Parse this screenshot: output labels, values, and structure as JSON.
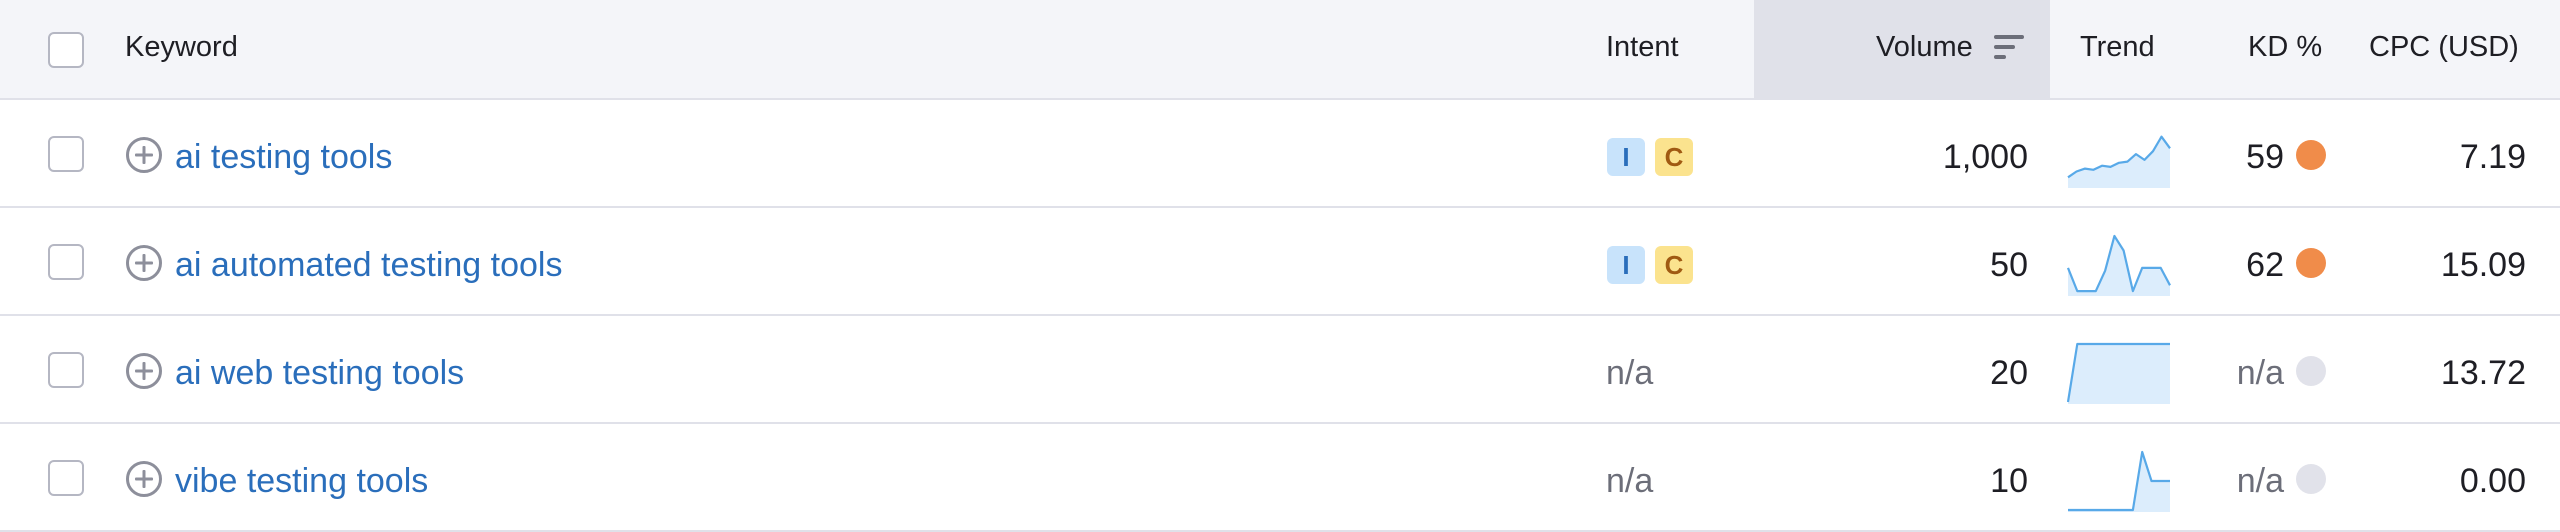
{
  "header": {
    "keyword": "Keyword",
    "intent": "Intent",
    "volume": "Volume",
    "trend": "Trend",
    "kd": "KD %",
    "cpc": "CPC (USD)"
  },
  "colors": {
    "link": "#2a6ebb",
    "kd_high": "#f08c4a",
    "kd_none": "#e1e2ea",
    "spark_line": "#58a9e8",
    "spark_fill": "#dcedfc",
    "intent_i_bg": "#c8e3fb",
    "intent_c_bg": "#fbe38e"
  },
  "rows": [
    {
      "keyword": "ai testing tools",
      "intent": [
        "I",
        "C"
      ],
      "volume": "1,000",
      "trend": [
        0.15,
        0.25,
        0.3,
        0.28,
        0.35,
        0.33,
        0.4,
        0.42,
        0.55,
        0.45,
        0.6,
        0.85,
        0.65
      ],
      "kd": "59",
      "kd_level": "hard",
      "cpc": "7.19"
    },
    {
      "keyword": "ai automated testing tools",
      "intent": [
        "I",
        "C"
      ],
      "volume": "50",
      "trend": [
        0.45,
        0.05,
        0.05,
        0.05,
        0.4,
        1.0,
        0.75,
        0.05,
        0.45,
        0.45,
        0.45,
        0.15
      ],
      "kd": "62",
      "kd_level": "hard",
      "cpc": "15.09"
    },
    {
      "keyword": "ai web testing tools",
      "intent": [],
      "intent_text": "n/a",
      "volume": "20",
      "trend": [
        0.0,
        1.0,
        1.0,
        1.0,
        1.0,
        1.0,
        1.0,
        1.0,
        1.0,
        1.0,
        1.0,
        1.0
      ],
      "kd": "n/a",
      "kd_level": "none",
      "cpc": "13.72"
    },
    {
      "keyword": "vibe testing tools",
      "intent": [],
      "intent_text": "n/a",
      "volume": "10",
      "trend": [
        0.0,
        0.0,
        0.0,
        0.0,
        0.0,
        0.0,
        0.0,
        0.0,
        1.0,
        0.5,
        0.5,
        0.5
      ],
      "kd": "n/a",
      "kd_level": "none",
      "cpc": "0.00"
    }
  ]
}
